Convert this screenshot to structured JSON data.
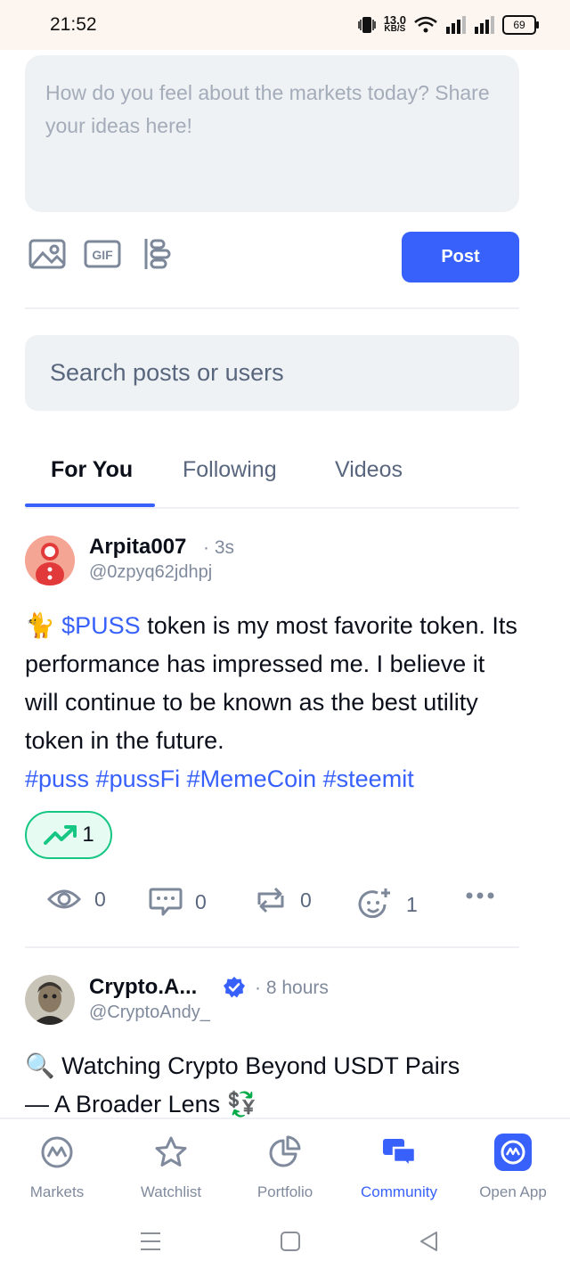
{
  "status_bar": {
    "time": "21:52",
    "net_speed": "13.0",
    "net_unit": "KB/S",
    "battery": "69"
  },
  "composer": {
    "placeholder": "How do you feel about the markets today? Share your ideas here!",
    "tools": [
      "image-icon",
      "gif-icon",
      "poll-icon"
    ],
    "gif_label": "GIF",
    "post_label": "Post"
  },
  "search": {
    "placeholder": "Search posts or users"
  },
  "tabs": [
    {
      "label": "For You",
      "active": true
    },
    {
      "label": "Following",
      "active": false
    },
    {
      "label": "Videos",
      "active": false
    }
  ],
  "posts": [
    {
      "author": "Arpita007",
      "time": "· 3s",
      "handle": "@0zpyq62jdhpj",
      "emoji": "🐈",
      "ticker": "$PUSS",
      "text": " token is my most favorite token. Its performance has impressed me. I believe it will continue to be known as the best utility token in the future.",
      "hashtags": "#puss #pussFi #MemeCoin #steemit",
      "trend_count": "1",
      "stats": {
        "views": "0",
        "comments": "0",
        "reposts": "0",
        "reactions": "1"
      }
    },
    {
      "author": "Crypto.A...",
      "verified": true,
      "time": "· 8 hours",
      "handle": "@CryptoAndy_",
      "text_line1": "🔍 Watching Crypto Beyond USDT Pairs",
      "text_line2": "— A Broader Lens 💱"
    }
  ],
  "bottom_nav": [
    {
      "label": "Markets",
      "icon": "markets-icon"
    },
    {
      "label": "Watchlist",
      "icon": "star-icon"
    },
    {
      "label": "Portfolio",
      "icon": "pie-chart-icon"
    },
    {
      "label": "Community",
      "icon": "chat-icon",
      "active": true
    },
    {
      "label": "Open App",
      "icon": "app-icon"
    }
  ],
  "colors": {
    "accent": "#3861fb",
    "positive": "#16c784",
    "muted": "#58667e"
  }
}
